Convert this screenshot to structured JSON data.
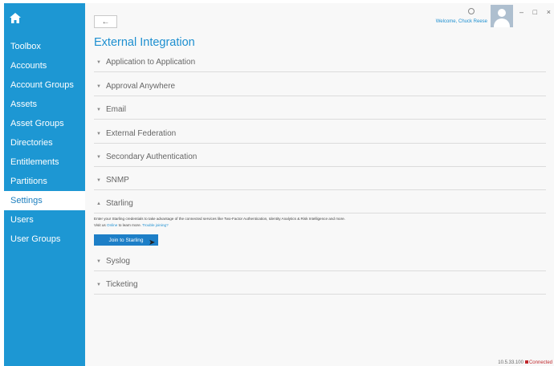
{
  "sidebar": {
    "items": [
      {
        "label": "Toolbox"
      },
      {
        "label": "Accounts"
      },
      {
        "label": "Account Groups"
      },
      {
        "label": "Assets"
      },
      {
        "label": "Asset Groups"
      },
      {
        "label": "Directories"
      },
      {
        "label": "Entitlements"
      },
      {
        "label": "Partitions"
      },
      {
        "label": "Settings",
        "active": true
      },
      {
        "label": "Users"
      },
      {
        "label": "User Groups"
      }
    ]
  },
  "header": {
    "back_symbol": "←",
    "welcome": "Welcome, Chuck Reese",
    "minimize": "–",
    "maximize": "□",
    "close": "×"
  },
  "page": {
    "title": "External Integration",
    "sections": [
      {
        "label": "Application to Application"
      },
      {
        "label": "Approval Anywhere"
      },
      {
        "label": "Email"
      },
      {
        "label": "External Federation"
      },
      {
        "label": "Secondary Authentication"
      },
      {
        "label": "SNMP"
      },
      {
        "label": "Starling",
        "expanded": true
      },
      {
        "label": "Syslog"
      },
      {
        "label": "Ticketing"
      }
    ],
    "starling": {
      "description": "Enter your Starling credentials to take advantage of the connected services like Two-Factor Authentication, Identity Analytics & Risk Intelligence and more.",
      "visit_prefix": "Visit us",
      "online_link": "Online",
      "visit_middle": "to learn more.",
      "trouble_link": "Trouble joining?",
      "join_button": "Join to Starling"
    }
  },
  "status_bar": {
    "address": "10.5.33.100",
    "connection": "Connected"
  },
  "colors": {
    "sidebar": "#1d97d3",
    "accent": "#1d8fd0",
    "button": "#1d7fc7",
    "connected": "#c0282c"
  }
}
